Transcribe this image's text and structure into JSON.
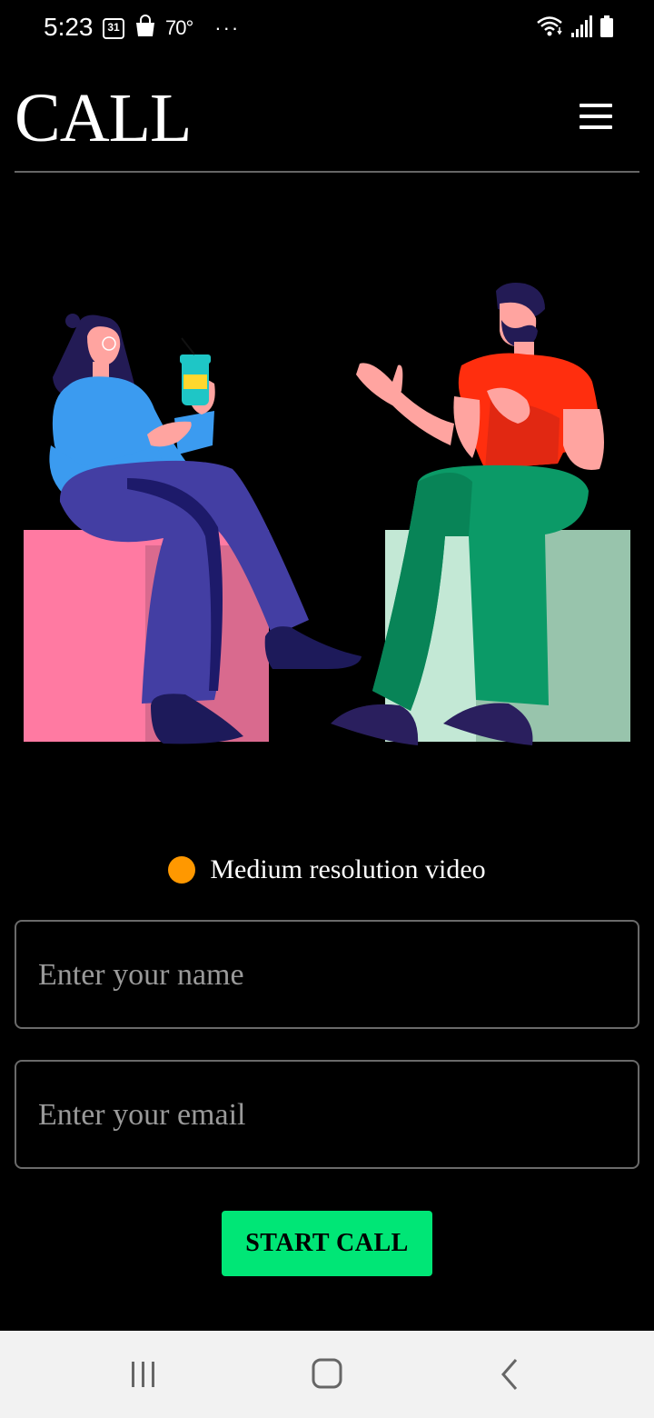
{
  "status_bar": {
    "time": "5:23",
    "calendar_day": "31",
    "temperature": "70°",
    "more": "···",
    "icons": [
      "calendar-icon",
      "shopping-bag-icon",
      "wifi-icon",
      "signal-icon",
      "battery-icon"
    ]
  },
  "header": {
    "title": "CALL",
    "menu_icon": "hamburger-menu-icon"
  },
  "resolution": {
    "label": "Medium resolution video",
    "indicator_color": "#ff9800"
  },
  "form": {
    "name_placeholder": "Enter your name",
    "name_value": "",
    "email_placeholder": "Enter your email",
    "email_value": ""
  },
  "start_button": {
    "label": "START CALL",
    "color": "#00e676"
  },
  "nav_bar": {
    "icons": [
      "recent-apps-icon",
      "home-icon",
      "back-icon"
    ]
  }
}
